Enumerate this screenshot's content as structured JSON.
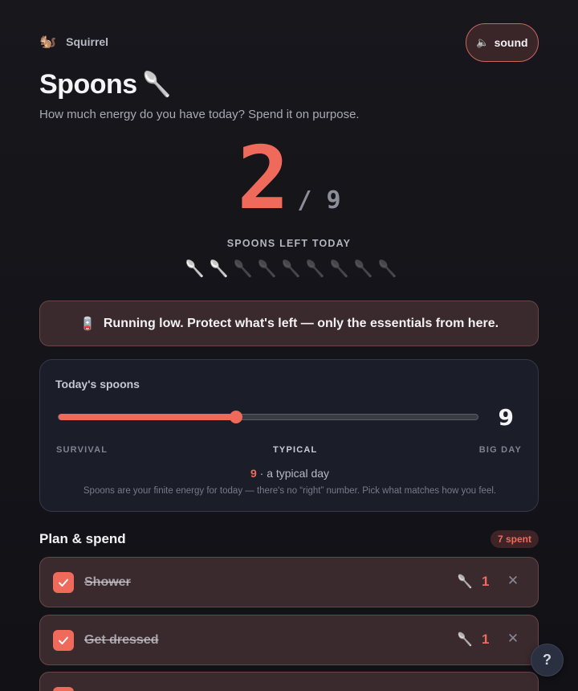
{
  "brand": {
    "icon": "🐿️",
    "name": "Squirrel"
  },
  "sound_button": {
    "icon": "🔈",
    "label": "sound"
  },
  "header": {
    "title": "Spoons",
    "title_icon": "🥄",
    "subtitle": "How much energy do you have today? Spend it on purpose."
  },
  "counter": {
    "remaining": "2",
    "total_label": "/ 9",
    "caption": "SPOONS LEFT TODAY",
    "total": 9,
    "remaining_value": 2
  },
  "spoon_glyph": "🥄",
  "alert": {
    "icon": "🪫",
    "text": "Running low. Protect what's left — only the essentials from here."
  },
  "budget_card": {
    "title": "Today's spoons",
    "value": "9",
    "slider": {
      "min": 1,
      "max": 20,
      "value": 9
    },
    "scale": {
      "low": "SURVIVAL",
      "mid": "TYPICAL",
      "high": "BIG DAY"
    },
    "summary_value": "9",
    "summary_text": "· a typical day",
    "note": "Spoons are your finite energy for today — there's no “right” number. Pick what matches how you feel."
  },
  "plan": {
    "title": "Plan & spend",
    "spent_badge": "7 spent",
    "tasks": [
      {
        "label": "Shower",
        "cost": "1",
        "done": true
      },
      {
        "label": "Get dressed",
        "cost": "1",
        "done": true
      }
    ]
  },
  "help_button": {
    "label": "?"
  },
  "colors": {
    "accent": "#f06a5c",
    "background": "#121217",
    "card": "#1b1e28",
    "alert_bg": "#3a2a2e"
  }
}
